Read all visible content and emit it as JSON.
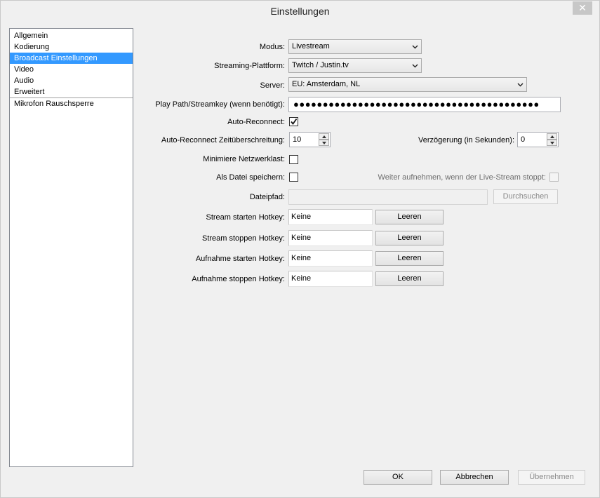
{
  "window": {
    "title": "Einstellungen",
    "close_glyph": "✕"
  },
  "sidebar": {
    "items": [
      {
        "label": "Allgemein"
      },
      {
        "label": "Kodierung"
      },
      {
        "label": "Broadcast Einstellungen",
        "selected": true
      },
      {
        "label": "Video"
      },
      {
        "label": "Audio"
      },
      {
        "label": "Erweitert"
      },
      {
        "label": "Mikrofon Rauschsperre"
      }
    ]
  },
  "form": {
    "mode_label": "Modus:",
    "mode_value": "Livestream",
    "platform_label": "Streaming-Plattform:",
    "platform_value": "Twitch / Justin.tv",
    "server_label": "Server:",
    "server_value": "EU: Amsterdam, NL",
    "streamkey_label": "Play Path/Streamkey (wenn benötigt):",
    "streamkey_value": "●●●●●●●●●●●●●●●●●●●●●●●●●●●●●●●●●●●●●●●●●●",
    "auto_reconnect_label": "Auto-Reconnect:",
    "auto_reconnect_checked": true,
    "auto_reconnect_timeout_label": "Auto-Reconnect Zeitüberschreitung:",
    "auto_reconnect_timeout_value": "10",
    "delay_label": "Verzögerung (in Sekunden):",
    "delay_value": "0",
    "minimize_network_label": "Minimiere Netzwerklast:",
    "minimize_network_checked": false,
    "save_file_label": "Als Datei speichern:",
    "save_file_checked": false,
    "keep_recording_label": "Weiter aufnehmen, wenn der Live-Stream stoppt:",
    "keep_recording_checked": false,
    "filepath_label": "Dateipfad:",
    "filepath_value": "",
    "browse_label": "Durchsuchen"
  },
  "hotkeys": [
    {
      "label": "Stream starten Hotkey:",
      "value": "Keine",
      "clear_label": "Leeren"
    },
    {
      "label": "Stream stoppen Hotkey:",
      "value": "Keine",
      "clear_label": "Leeren"
    },
    {
      "label": "Aufnahme starten Hotkey:",
      "value": "Keine",
      "clear_label": "Leeren"
    },
    {
      "label": "Aufnahme stoppen Hotkey:",
      "value": "Keine",
      "clear_label": "Leeren"
    }
  ],
  "footer": {
    "ok_label": "OK",
    "cancel_label": "Abbrechen",
    "apply_label": "Übernehmen"
  },
  "icons": {
    "chevron": "chevron-down-icon",
    "check": "checkmark-icon",
    "spin_up": "arrow-up-icon",
    "spin_down": "arrow-down-icon"
  }
}
